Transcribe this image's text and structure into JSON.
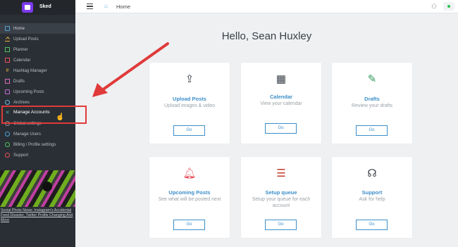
{
  "brand": {
    "name": "Sked"
  },
  "topbar": {
    "breadcrumb": "Home"
  },
  "sidebar": {
    "items": [
      {
        "label": "Home",
        "icon": "home-icon"
      },
      {
        "label": "Upload Posts",
        "icon": "upload-icon"
      },
      {
        "label": "Planner",
        "icon": "grid-icon"
      },
      {
        "label": "Calendar",
        "icon": "calendar-icon"
      },
      {
        "label": "Hashtag Manager",
        "icon": "hashtag-icon"
      },
      {
        "label": "Drafts",
        "icon": "drafts-icon"
      },
      {
        "label": "Upcoming Posts",
        "icon": "clock-icon"
      },
      {
        "label": "Archives",
        "icon": "archive-icon"
      },
      {
        "label": "Manage Accounts",
        "icon": "accounts-icon"
      },
      {
        "label": "Global settings",
        "icon": "settings-icon"
      },
      {
        "label": "Manage Users",
        "icon": "users-icon"
      },
      {
        "label": "Billing / Profile settings",
        "icon": "billing-icon"
      },
      {
        "label": "Support",
        "icon": "support-icon"
      }
    ],
    "promo_text": "Social Photo News: Instagram's Accidental Feed Disaster, Twitter Profile Changing And More"
  },
  "main": {
    "greeting": "Hello, Sean Huxley",
    "cards": [
      {
        "title": "Upload Posts",
        "desc": "Upload images & video",
        "button": "Go",
        "icon": "upload-icon",
        "color": "#3a4048"
      },
      {
        "title": "Calendar",
        "desc": "View your calendar",
        "button": "Go",
        "icon": "calendar-icon",
        "color": "#3a4048"
      },
      {
        "title": "Drafts",
        "desc": "Review your drafts",
        "button": "Go",
        "icon": "drafts-icon",
        "color": "#2e9a5b"
      },
      {
        "title": "Upcoming Posts",
        "desc": "See what will be posted next",
        "button": "Go",
        "icon": "bell-icon",
        "color": "#e8505b"
      },
      {
        "title": "Setup queue",
        "desc": "Setup your queue for each account",
        "button": "Go",
        "icon": "queue-icon",
        "color": "#c0392b"
      },
      {
        "title": "Support",
        "desc": "Ask for help",
        "button": "Go",
        "icon": "headset-icon",
        "color": "#3a4048"
      }
    ]
  },
  "annotation": {
    "highlight_color": "#e03a3a"
  }
}
